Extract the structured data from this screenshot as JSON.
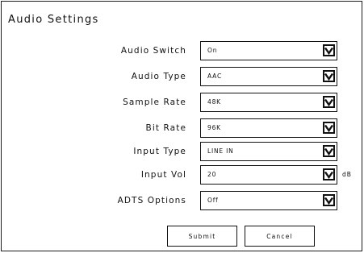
{
  "title": "Audio Settings",
  "fields": [
    {
      "label": "Audio Switch",
      "value": "On"
    },
    {
      "label": "Audio Type",
      "value": "AAC"
    },
    {
      "label": "Sample Rate",
      "value": "48K"
    },
    {
      "label": "Bit Rate",
      "value": "96K"
    },
    {
      "label": "Input Type",
      "value": "LINE IN"
    },
    {
      "label": "Input Vol",
      "value": "20",
      "unit": "dB"
    },
    {
      "label": "ADTS Options",
      "value": "Off"
    }
  ],
  "buttons": {
    "submit": "Submit",
    "cancel": "Cancel"
  },
  "icons": {
    "dropdown": "chevron-down-icon"
  }
}
